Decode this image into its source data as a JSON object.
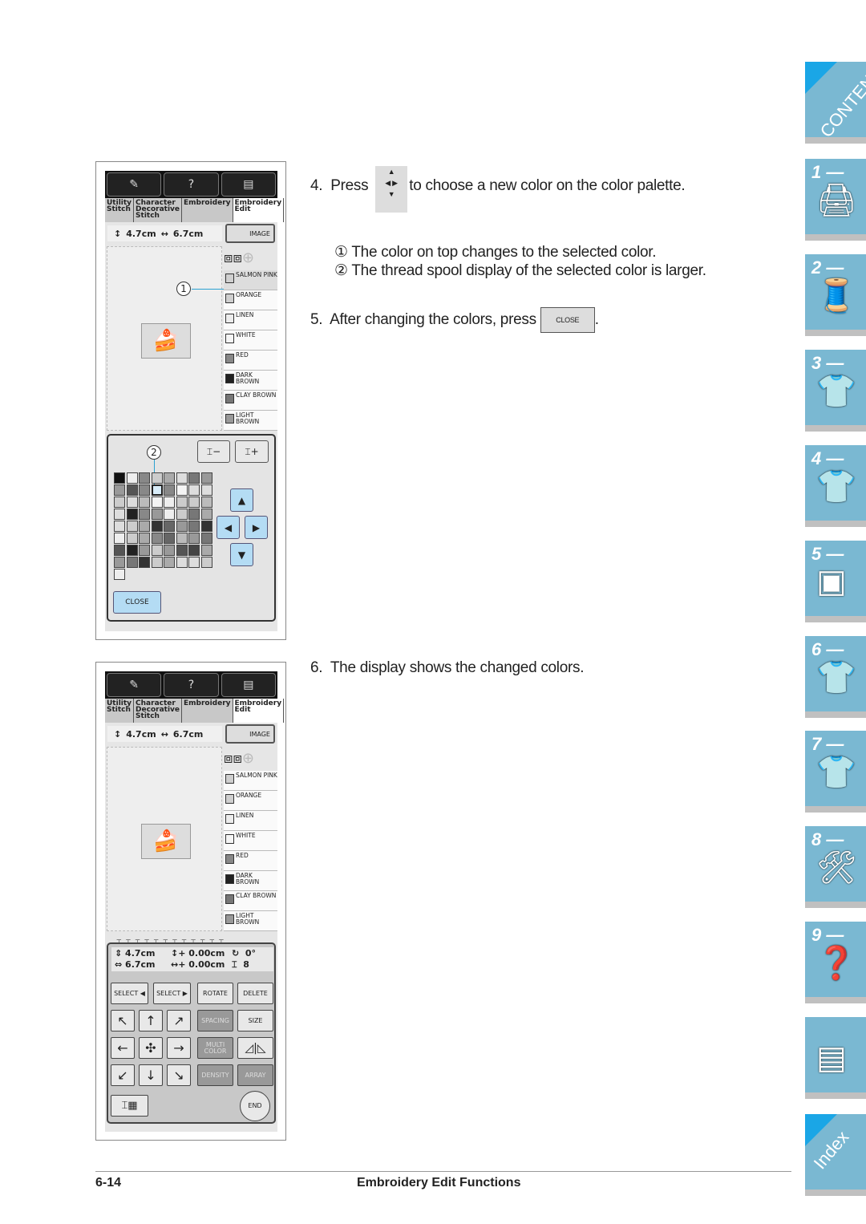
{
  "screen": {
    "top_tabs": [
      "Utility Stitch",
      "Character Decorative Stitch",
      "Embroidery",
      "Embroidery Edit"
    ],
    "height": "4.7cm",
    "width": "6.7cm",
    "image_button": "IMAGE",
    "threads": [
      "SALMON PINK",
      "ORANGE",
      "LINEN",
      "WHITE",
      "RED",
      "DARK BROWN",
      "CLAY BROWN",
      "LIGHT BROWN"
    ],
    "thread_colors": [
      "#cfcfcf",
      "#cfcfcf",
      "#ececec",
      "#f4f4f4",
      "#888888",
      "#222222",
      "#777777",
      "#999999"
    ],
    "callout_1": "1",
    "callout_2": "2",
    "spool_minus": "−",
    "spool_plus": "+",
    "close": "CLOSE",
    "arrows": {
      "up": "▲",
      "down": "▼",
      "left": "◀",
      "right": "▶"
    }
  },
  "palette_colors": [
    "#111",
    "#eee",
    "#888",
    "#ccc",
    "#aaa",
    "#ddd",
    "#777",
    "#999",
    "#999",
    "#555",
    "#888",
    "#d8ecf8",
    "#888",
    "#f4f4f4",
    "#ddd",
    "#ddd",
    "#ccc",
    "#ddd",
    "#bbb",
    "#f4f4f4",
    "#eee",
    "#ccc",
    "#ccc",
    "#bbb",
    "#ddd",
    "#222",
    "#888",
    "#999",
    "#eee",
    "#ccc",
    "#777",
    "#aaa",
    "#ddd",
    "#ccc",
    "#aaa",
    "#333",
    "#666",
    "#999",
    "#777",
    "#333",
    "#eee",
    "#ccc",
    "#aaa",
    "#888",
    "#666",
    "#bbb",
    "#999",
    "#777",
    "#555",
    "#222",
    "#999",
    "#ccc",
    "#999",
    "#555",
    "#444",
    "#aaa",
    "#999",
    "#777",
    "#333",
    "#ccc",
    "#aaa",
    "#ddd",
    "#ddd",
    "#ccc",
    "#eee"
  ],
  "edit": {
    "height": "4.7cm",
    "width": "6.7cm",
    "vmove": "0.00cm",
    "hmove": "0.00cm",
    "angle": "0°",
    "colors": "8",
    "select_left": "SELECT ◀",
    "select_right": "SELECT ▶",
    "rotate": "ROTATE",
    "delete": "DELETE",
    "spacing": "SPACING",
    "size": "SIZE",
    "multi_color": "MULTI COLOR",
    "density": "DENSITY",
    "array": "ARRAY",
    "end": "END",
    "arrows": [
      "↖",
      "↑",
      "↗",
      "←",
      "✣",
      "→",
      "↙",
      "↓",
      "↘"
    ]
  },
  "steps": [
    {
      "num": "4.",
      "before": "Press",
      "after": "to choose a new color on the color palette."
    },
    {
      "num": "5.",
      "before": "After changing the colors, press",
      "after": ".",
      "button": "CLOSE"
    },
    {
      "num": "6.",
      "before": "The display shows the changed colors."
    }
  ],
  "notes": [
    {
      "mark": "①",
      "text": "The color on top changes to the selected color."
    },
    {
      "mark": "②",
      "text": "The thread spool display of the selected color is larger."
    }
  ],
  "side_tabs": [
    "CONTENTS",
    "1 —",
    "2 —",
    "3 —",
    "4 —",
    "5 —",
    "6 —",
    "7 —",
    "8 —",
    "9 —",
    "",
    "Index"
  ],
  "side_icons": [
    "",
    "sewing-machine",
    "thread-spool",
    "t-shirt",
    "t-shirt-abc",
    "hoop",
    "t-shirt-embroidery",
    "t-shirt-edit",
    "machine-maintenance",
    "troubleshooting",
    "pages",
    ""
  ],
  "footer": {
    "page": "6-14",
    "title": "Embroidery Edit Functions"
  },
  "colors": {
    "tab": "#7ab8d2",
    "tab_corner": "#1aa6e6",
    "button_blue": "#b4dcf4"
  }
}
